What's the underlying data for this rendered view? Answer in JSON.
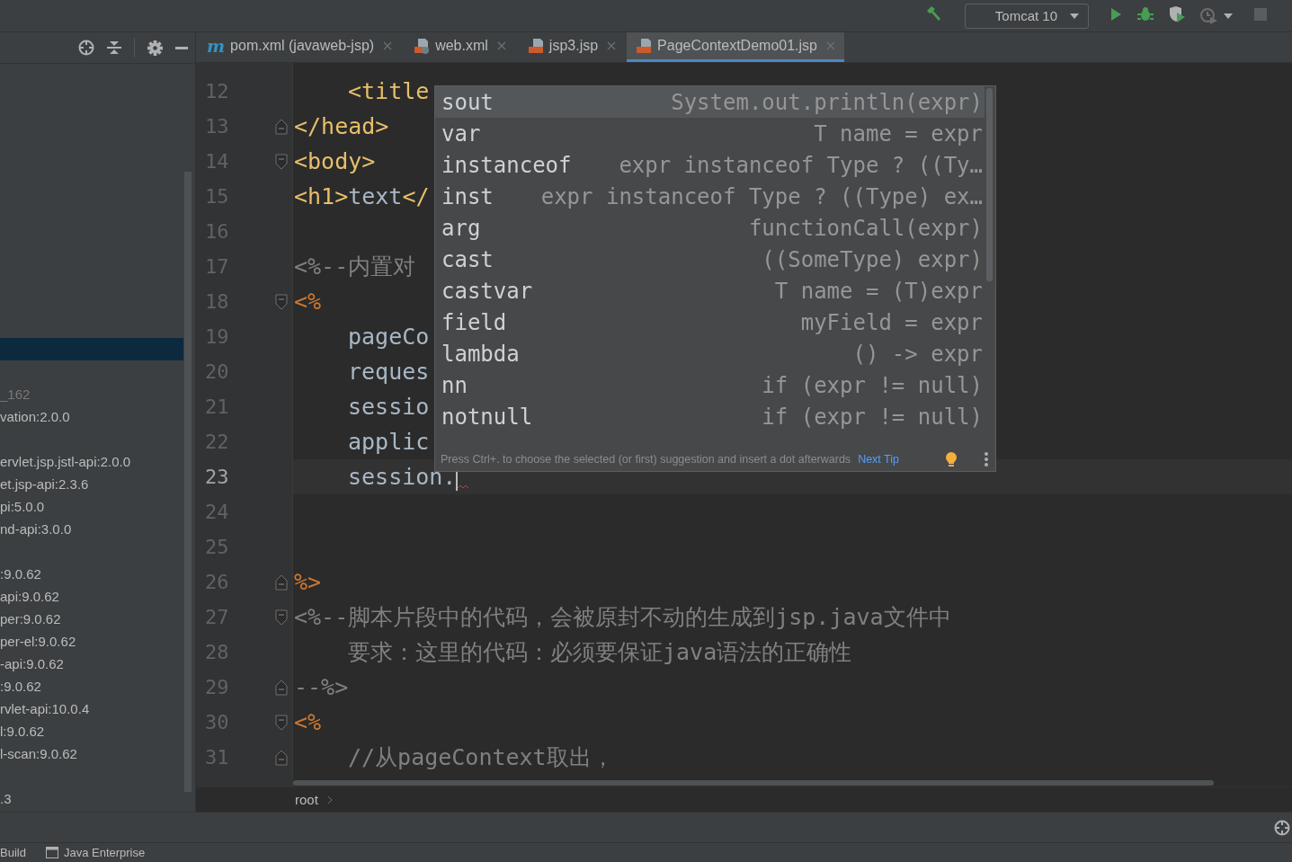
{
  "toolbar": {
    "run_config": "Tomcat 10"
  },
  "project_panel": {
    "items": [
      {
        "selected": true
      },
      {
        "selected": false
      },
      {
        "text": "_162",
        "selected": false,
        "dim": true
      },
      {
        "text": "vation:2.0.0",
        "selected": false
      },
      {
        "selected": false
      },
      {
        "text": "ervlet.jsp.jstl-api:2.0.0",
        "selected": false
      },
      {
        "text": "et.jsp-api:2.3.6",
        "selected": false
      },
      {
        "text": "pi:5.0.0",
        "selected": false
      },
      {
        "text": "nd-api:3.0.0",
        "selected": false
      },
      {
        "selected": false
      },
      {
        "text": ":9.0.62",
        "selected": false
      },
      {
        "text": "api:9.0.62",
        "selected": false
      },
      {
        "text": "per:9.0.62",
        "selected": false
      },
      {
        "text": "per-el:9.0.62",
        "selected": false
      },
      {
        "text": "-api:9.0.62",
        "selected": false
      },
      {
        "text": ":9.0.62",
        "selected": false
      },
      {
        "text": "rvlet-api:10.0.4",
        "selected": false
      },
      {
        "text": "l:9.0.62",
        "selected": false
      },
      {
        "text": "l-scan:9.0.62",
        "selected": false
      },
      {
        "selected": false
      },
      {
        "text": ".3",
        "selected": false
      }
    ]
  },
  "tabs": [
    {
      "label": "pom.xml (javaweb-jsp)",
      "kind": "maven",
      "icon_glyph": "m",
      "selected": false
    },
    {
      "label": "web.xml",
      "kind": "xml",
      "selected": false
    },
    {
      "label": "jsp3.jsp",
      "kind": "jsp",
      "selected": false
    },
    {
      "label": "PageContextDemo01.jsp",
      "kind": "jsp",
      "selected": true
    }
  ],
  "editor": {
    "lines": [
      {
        "number": "12",
        "kind": "plain",
        "indent": true,
        "current": false,
        "segments": [
          {
            "kind": "tag",
            "text": "<title"
          }
        ]
      },
      {
        "number": "13",
        "kind": "fold_end",
        "indent": false,
        "current": false,
        "segments": [
          {
            "kind": "tag",
            "text": "</head>"
          }
        ]
      },
      {
        "number": "14",
        "kind": "fold_start",
        "indent": false,
        "current": false,
        "segments": [
          {
            "kind": "tag",
            "text": "<body>"
          }
        ]
      },
      {
        "number": "15",
        "kind": "plain",
        "indent": false,
        "current": false,
        "segments": [
          {
            "kind": "tag",
            "text": "<h1>"
          },
          {
            "kind": "text",
            "text": "text"
          },
          {
            "kind": "tag",
            "text": "</"
          }
        ]
      },
      {
        "number": "16",
        "kind": "plain",
        "current": false
      },
      {
        "number": "17",
        "kind": "plain",
        "indent": false,
        "current": false,
        "segments": [
          {
            "kind": "comment",
            "text": "<%--内置对"
          }
        ]
      },
      {
        "number": "18",
        "kind": "fold_start",
        "indent": false,
        "current": false,
        "segments": [
          {
            "kind": "directive",
            "text": "<%"
          }
        ]
      },
      {
        "number": "19",
        "kind": "plain",
        "indent": true,
        "current": false,
        "segments": [
          {
            "kind": "text",
            "text": "pageCo"
          }
        ]
      },
      {
        "number": "20",
        "kind": "plain",
        "indent": true,
        "current": false,
        "segments": [
          {
            "kind": "text",
            "text": "reques"
          }
        ]
      },
      {
        "number": "21",
        "kind": "plain",
        "indent": true,
        "current": false,
        "segments": [
          {
            "kind": "text",
            "text": "sessio"
          }
        ]
      },
      {
        "number": "22",
        "kind": "plain",
        "indent": true,
        "current": false,
        "segments": [
          {
            "kind": "text",
            "text": "applic"
          }
        ]
      },
      {
        "number": "23",
        "kind": "plain",
        "indent": true,
        "current": true,
        "segments": [
          {
            "kind": "text",
            "text": "session."
          }
        ]
      },
      {
        "number": "24",
        "kind": "plain",
        "current": false
      },
      {
        "number": "25",
        "kind": "plain",
        "current": false
      },
      {
        "number": "26",
        "kind": "fold_end",
        "indent": false,
        "current": false,
        "segments": [
          {
            "kind": "directive",
            "text": "%>"
          }
        ]
      },
      {
        "number": "27",
        "kind": "fold_start",
        "indent": false,
        "current": false,
        "segments": [
          {
            "kind": "comment",
            "text": "<%--脚本片段中的代码，会被原封不动的生成到jsp.java文件中"
          }
        ]
      },
      {
        "number": "28",
        "kind": "plain",
        "indent": true,
        "current": false,
        "segments": [
          {
            "kind": "comment",
            "text": "要求：这里的代码：必须要保证java语法的正确性"
          }
        ]
      },
      {
        "number": "29",
        "kind": "fold_end",
        "indent": false,
        "current": false,
        "segments": [
          {
            "kind": "comment",
            "text": "--%>"
          }
        ]
      },
      {
        "number": "30",
        "kind": "fold_start",
        "indent": false,
        "current": false,
        "segments": [
          {
            "kind": "directive",
            "text": "<%"
          }
        ]
      },
      {
        "number": "31",
        "kind": "fold_end",
        "indent": true,
        "current": false,
        "segments": [
          {
            "kind": "comment",
            "text": "//从pageContext取出，"
          }
        ]
      }
    ]
  },
  "completion": {
    "items": [
      {
        "name": "sout",
        "description": "System.out.println(expr)",
        "selected": true
      },
      {
        "name": "var",
        "description": "T name = expr",
        "selected": false
      },
      {
        "name": "instanceof",
        "description": "expr instanceof Type ? ((Ty…",
        "selected": false
      },
      {
        "name": "inst",
        "description": "expr instanceof Type ? ((Type) ex…",
        "selected": false
      },
      {
        "name": "arg",
        "description": "functionCall(expr)",
        "selected": false
      },
      {
        "name": "cast",
        "description": "((SomeType) expr)",
        "selected": false
      },
      {
        "name": "castvar",
        "description": "T name = (T)expr",
        "selected": false
      },
      {
        "name": "field",
        "description": "myField = expr",
        "selected": false
      },
      {
        "name": "lambda",
        "description": "() -> expr",
        "selected": false
      },
      {
        "name": "nn",
        "description": "if (expr != null)",
        "selected": false
      },
      {
        "name": "notnull",
        "description": "if (expr != null)",
        "selected": false
      }
    ],
    "hint": "Press Ctrl+. to choose the selected (or first) suggestion and insert a dot afterwards",
    "next_tip": "Next Tip"
  },
  "breadcrumb": [
    "root"
  ],
  "bottom_tabs": [
    {
      "label": "Build",
      "kind": "plain"
    },
    {
      "label": "Java Enterprise",
      "kind": "window"
    }
  ]
}
